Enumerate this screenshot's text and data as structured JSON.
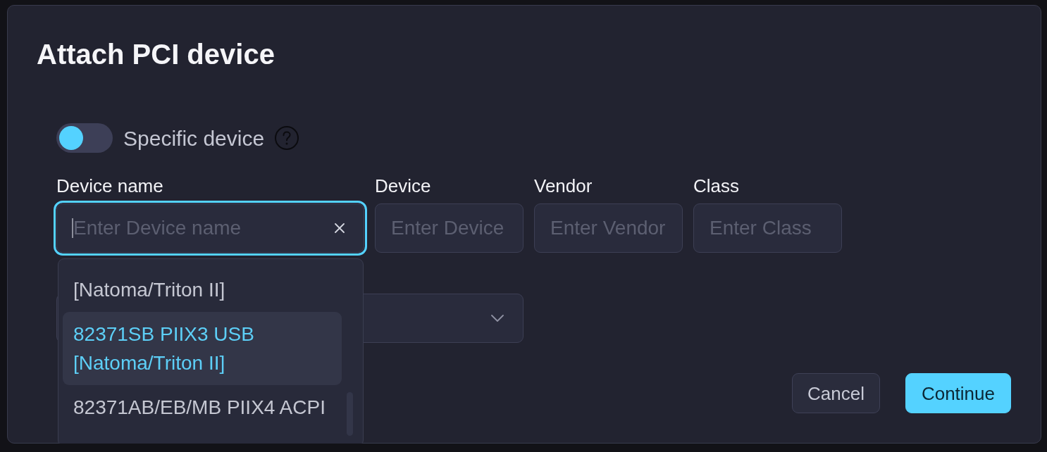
{
  "dialog": {
    "title": "Attach PCI device"
  },
  "specific_device": {
    "label": "Specific device",
    "on": false
  },
  "fields": [
    {
      "label": "Device name",
      "placeholder": "Enter Device name",
      "focused": true,
      "clear_button": true
    },
    {
      "label": "Device",
      "placeholder": "Enter Device",
      "focused": false,
      "clear_button": false
    },
    {
      "label": "Vendor",
      "placeholder": "Enter Vendor",
      "focused": false,
      "clear_button": false
    },
    {
      "label": "Class",
      "placeholder": "Enter Class",
      "focused": false,
      "clear_button": false
    }
  ],
  "dropdown": {
    "items": [
      {
        "text": "[Natoma/Triton II]",
        "selected": false
      },
      {
        "text": "82371SB PIIX3 USB [Natoma/Triton II]",
        "selected": true
      },
      {
        "text": "82371AB/EB/MB PIIX4 ACPI",
        "selected": false
      }
    ]
  },
  "buttons": [
    {
      "label": "Cancel",
      "kind": "secondary"
    },
    {
      "label": "Continue",
      "kind": "primary"
    }
  ]
}
